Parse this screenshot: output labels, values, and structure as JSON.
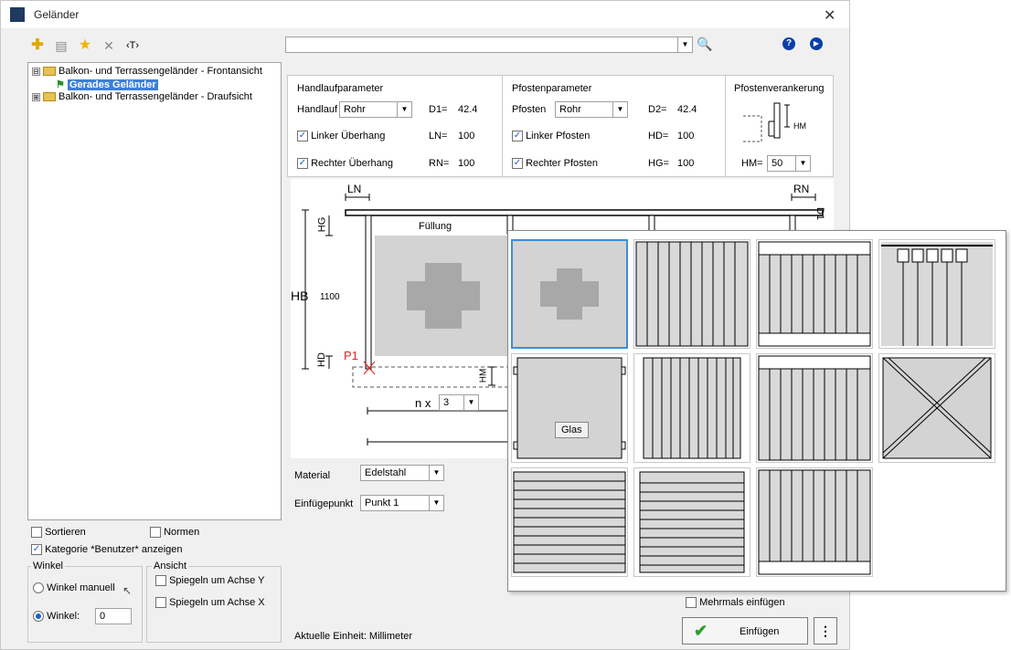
{
  "window": {
    "title": "Geländer"
  },
  "toolbar": {
    "text_tool": "‹T›"
  },
  "tree": {
    "items": [
      {
        "label": "Balkon- und Terrassengeländer - Frontansicht",
        "expander": "⊟"
      },
      {
        "label": "Gerades Geländer"
      },
      {
        "label": "Balkon- und Terrassengeländer - Draufsicht",
        "expander": "⊞"
      }
    ]
  },
  "handlauf": {
    "title": "Handlaufparameter",
    "label": "Handlauf",
    "value": "Rohr",
    "d1_label": "D1=",
    "d1_value": "42.4",
    "linker_label": "Linker Überhang",
    "ln_label": "LN=",
    "ln_value": "100",
    "rechter_label": "Rechter Überhang",
    "rn_label": "RN=",
    "rn_value": "100"
  },
  "pfosten": {
    "title": "Pfostenparameter",
    "label": "Pfosten",
    "value": "Rohr",
    "d2_label": "D2=",
    "d2_value": "42.4",
    "linker_label": "Linker Pfosten",
    "hd_label": "HD=",
    "hd_value": "100",
    "rechter_label": "Rechter Pfosten",
    "hg_label": "HG=",
    "hg_value": "100"
  },
  "verankerung": {
    "title": "Pfostenverankerung",
    "hm_label": "HM=",
    "hm_value": "50",
    "hm_diagram": "HM"
  },
  "drawing": {
    "ln": "LN",
    "rn": "RN",
    "d1": "D1",
    "hg": "HG",
    "fullung": "Füllung",
    "hb": "HB",
    "hb_value": "1100",
    "hd": "HD",
    "p1": "P1",
    "hm": "HM",
    "n_label": "n x",
    "n_value": "3"
  },
  "material": {
    "label": "Material",
    "value": "Edelstahl"
  },
  "einfuegepunkt": {
    "label": "Einfügepunkt",
    "value": "Punkt 1"
  },
  "options": {
    "sortieren": "Sortieren",
    "normen": "Normen",
    "kategorie": "Kategorie *Benutzer* anzeigen"
  },
  "winkel": {
    "title": "Winkel",
    "manuell": "Winkel manuell",
    "winkel_label": "Winkel:",
    "winkel_value": "0"
  },
  "ansicht": {
    "title": "Ansicht",
    "spiegeln_y": "Spiegeln um Achse Y",
    "spiegeln_x": "Spiegeln um Achse X"
  },
  "footer": {
    "unit": "Aktuelle Einheit: Millimeter",
    "mehrmals": "Mehrmals einfügen",
    "einfuegen": "Einfügen",
    "more": "⋮"
  },
  "popup": {
    "glas_label": "Glas"
  },
  "colors": {
    "accent": "#1a5fd0",
    "selection": "#3c7fd6",
    "fill_gray": "#d3d3d3",
    "plus_gray": "#a8a8a8",
    "p1_red": "#e02020"
  }
}
